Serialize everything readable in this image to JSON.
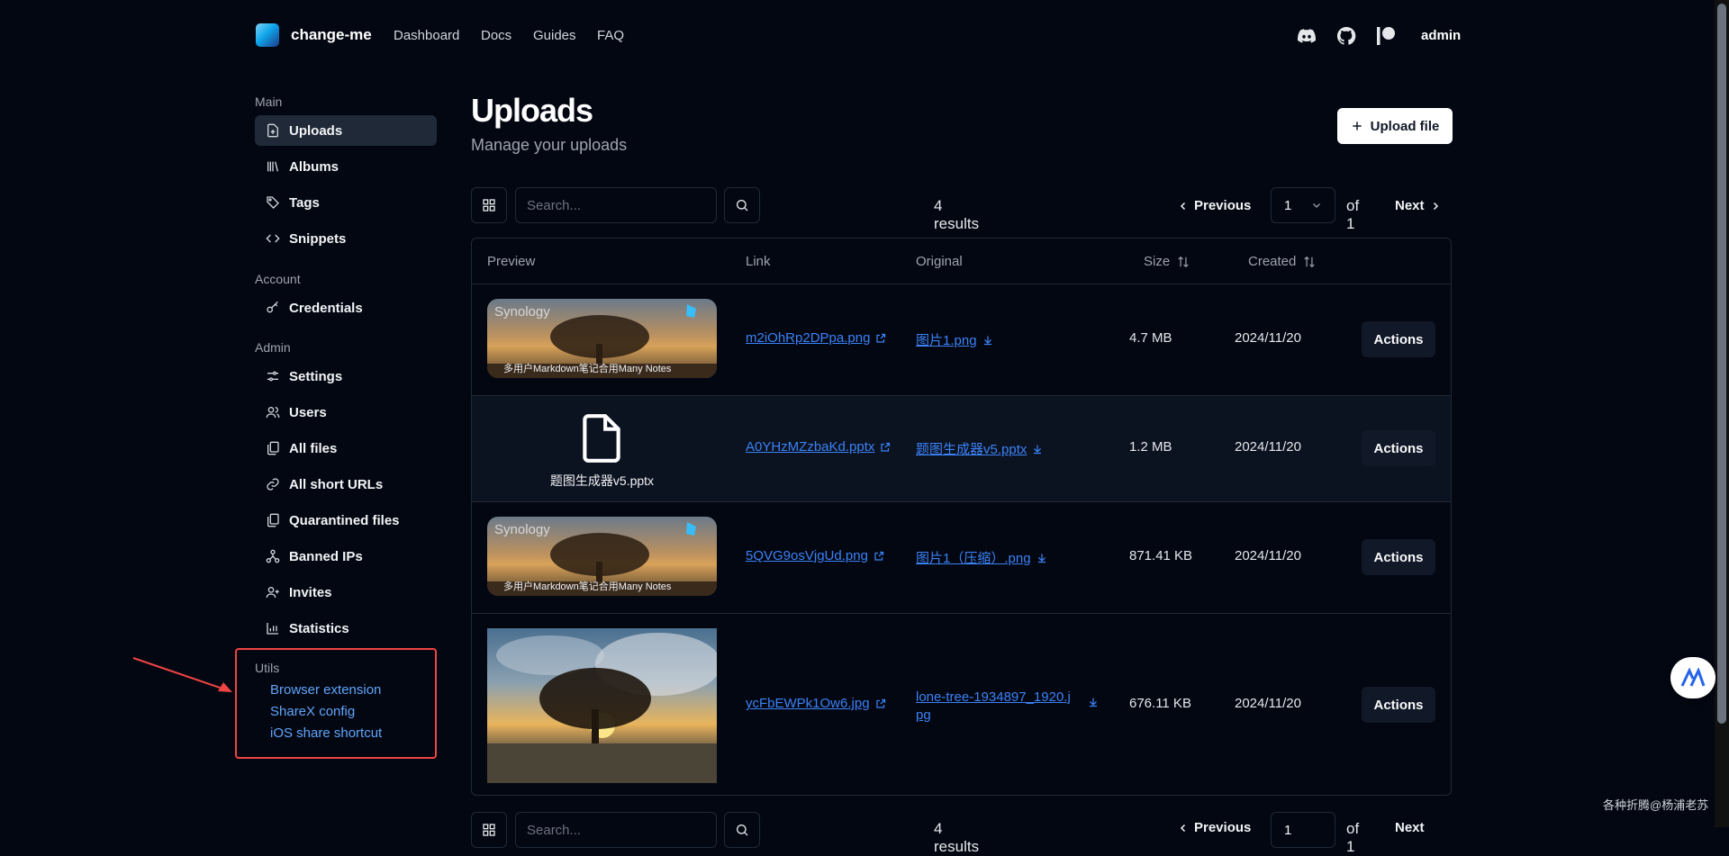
{
  "brand": {
    "name": "change-me"
  },
  "nav": {
    "links": [
      "Dashboard",
      "Docs",
      "Guides",
      "FAQ"
    ],
    "user": "admin"
  },
  "sidebar": {
    "main_label": "Main",
    "main_items": [
      "Uploads",
      "Albums",
      "Tags",
      "Snippets"
    ],
    "account_label": "Account",
    "account_items": [
      "Credentials"
    ],
    "admin_label": "Admin",
    "admin_items": [
      "Settings",
      "Users",
      "All files",
      "All short URLs",
      "Quarantined files",
      "Banned IPs",
      "Invites",
      "Statistics"
    ],
    "utils_label": "Utils",
    "utils_items": [
      "Browser extension",
      "ShareX config",
      "iOS share shortcut"
    ]
  },
  "page": {
    "title": "Uploads",
    "subtitle": "Manage your uploads",
    "upload_button": "Upload file"
  },
  "toolbar": {
    "search_placeholder": "Search...",
    "results": "4 results",
    "previous": "Previous",
    "page": "1",
    "of": "of 1",
    "next": "Next"
  },
  "table": {
    "headers": [
      "Preview",
      "Link",
      "Original",
      "Size",
      "Created"
    ],
    "rows": [
      {
        "preview": "image",
        "preview_text": "Synology",
        "preview_caption": "多用户Markdown笔记合用Many Notes",
        "link": "m2iOhRp2DPpa.png",
        "original": "图片1.png",
        "size": "4.7 MB",
        "created": "2024/11/20",
        "action": "Actions"
      },
      {
        "preview": "file",
        "preview_caption": "题图生成器v5.pptx",
        "link": "A0YHzMZzbaKd.pptx",
        "original": "题图生成器v5.pptx",
        "size": "1.2 MB",
        "created": "2024/11/20",
        "action": "Actions"
      },
      {
        "preview": "image",
        "preview_text": "Synology",
        "preview_caption": "多用户Markdown笔记合用Many Notes",
        "link": "5QVG9osVjgUd.png",
        "original": "图片1（压缩）.png",
        "size": "871.41 KB",
        "created": "2024/11/20",
        "action": "Actions"
      },
      {
        "preview": "photo",
        "link": "ycFbEWPk1Ow6.jpg",
        "original": "lone-tree-1934897_1920.jpg",
        "size": "676.11 KB",
        "created": "2024/11/20",
        "action": "Actions"
      }
    ]
  },
  "watermark": "各种折腾@杨浦老苏",
  "colors": {
    "background": "#030712",
    "accent_link": "#3b82f6",
    "util_link": "#60a5fa",
    "highlight_box": "#ef4444"
  }
}
